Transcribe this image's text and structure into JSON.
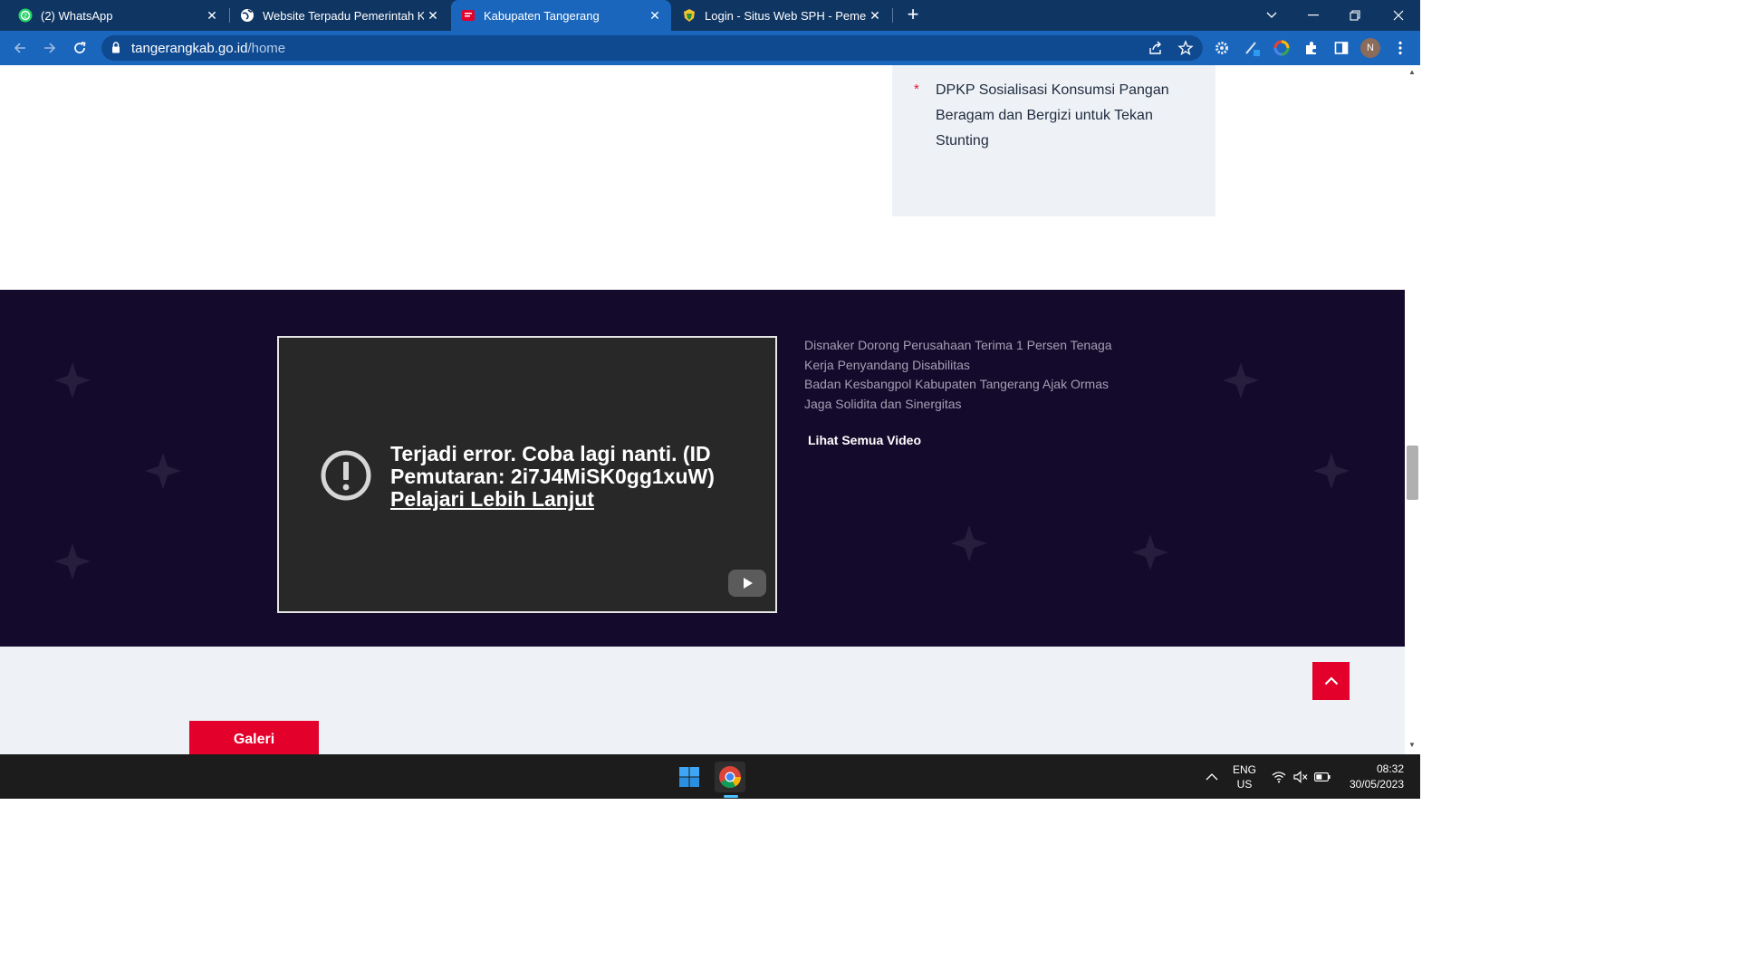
{
  "browser": {
    "tabs": [
      {
        "title": "(2) WhatsApp",
        "icon": "whatsapp-icon",
        "active": false
      },
      {
        "title": "Website Terpadu Pemerintah Kab",
        "icon": "globe-icon",
        "active": false
      },
      {
        "title": "Kabupaten Tangerang",
        "icon": "site-favicon",
        "active": true
      },
      {
        "title": "Login - Situs Web SPH - Pemerin",
        "icon": "emblem-icon",
        "active": false
      }
    ],
    "url_domain": "tangerangkab.go.id",
    "url_path": "/home",
    "profile_initial": "N",
    "colors": {
      "tabbar": "#0f3563",
      "toolbar": "#1a66bd"
    }
  },
  "news_card": {
    "headline": "DPKP Sosialisasi Konsumsi Pangan Beragam dan Bergizi untuk Tekan Stunting",
    "bullet": "*"
  },
  "video": {
    "error_message": "Terjadi error. Coba lagi nanti. (ID Pemutaran: 2i7J4MiSK0gg1xuW)",
    "learn_more": "Pelajari Lebih Lanjut",
    "list": [
      "Disnaker Dorong Perusahaan Terima 1 Persen Tenaga Kerja Penyandang Disabilitas",
      "Badan Kesbangpol Kabupaten Tangerang Ajak Ormas Jaga Solidita dan Sinergitas"
    ],
    "see_all": "Lihat Semua Video"
  },
  "gallery": {
    "button": "Galeri"
  },
  "taskbar": {
    "lang_line1": "ENG",
    "lang_line2": "US",
    "time": "08:32",
    "date": "30/05/2023"
  }
}
